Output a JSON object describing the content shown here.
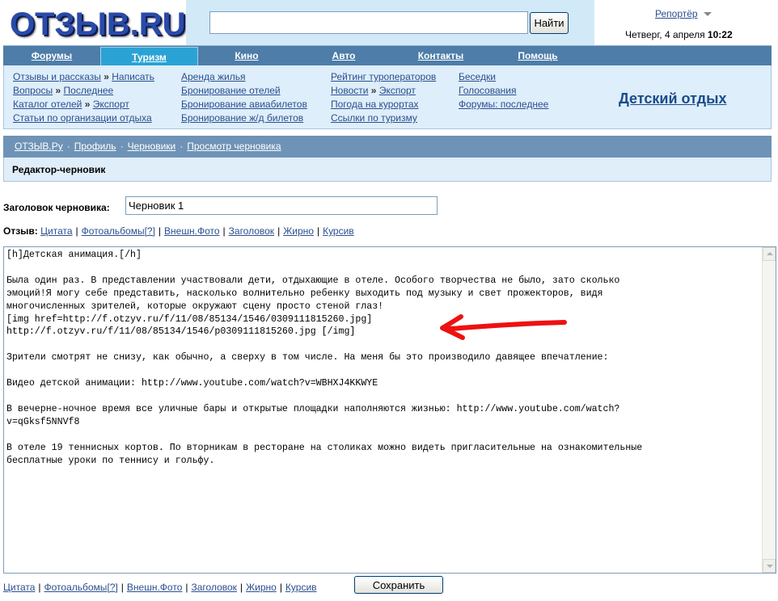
{
  "header": {
    "logo_text": "ОТЗЫВ.RU",
    "search_placeholder": "",
    "search_value": "",
    "search_button": "Найти",
    "reporter_label": "Репортёр",
    "date_text": "Четверг, 4 апреля",
    "time_text": "10:22"
  },
  "nav": {
    "tabs": [
      {
        "label": "Форумы"
      },
      {
        "label": "Туризм",
        "active": true
      },
      {
        "label": "Кино"
      },
      {
        "label": "Авто"
      },
      {
        "label": "Контакты"
      },
      {
        "label": "Помощь"
      }
    ]
  },
  "submenu": {
    "col1": {
      "r1a": "Отзывы и рассказы",
      "r1b": "Написать",
      "r2a": "Вопросы",
      "r2b": "Последнее",
      "r3a": "Каталог отелей",
      "r3b": "Экспорт",
      "r4": "Статьи по организации отдыха",
      "sep": "»"
    },
    "col2": [
      "Аренда жилья",
      "Бронирование отелей",
      "Бронирование авиабилетов",
      "Бронирование ж/д билетов"
    ],
    "col3": {
      "r1": "Рейтинг туроператоров",
      "r2a": "Новости",
      "r2b": "Экспорт",
      "r3": "Погода на курортах",
      "r4": "Ссылки по туризму"
    },
    "col4": [
      "Беседки",
      "Голосования",
      "Форумы: последнее"
    ],
    "kids_link": "Детский отдых"
  },
  "breadcrumb": {
    "items": [
      "ОТЗЫВ.Ру",
      "Профиль",
      "Черновики",
      "Просмотр черновика"
    ],
    "dot": "·"
  },
  "page_title": "Редактор-черновик",
  "draft": {
    "label": "Заголовок черновика:",
    "value": "Черновик 1"
  },
  "toolbar": {
    "label": "Отзыв:",
    "quote": "Цитата",
    "albums": "Фотоальбомы",
    "albums_help": "[?]",
    "external_photo": "Внешн.Фото",
    "heading": "Заголовок",
    "bold": "Жирно",
    "italic": "Курсив",
    "pipe": "|"
  },
  "editor": {
    "text": "[h]Детская анимация.[/h]\n\nБыла один раз. В представлении участвовали дети, отдыхающие в отеле. Особого творчества не было, зато сколько\nэмоций!Я могу себе представить, насколько волнительно ребенку выходить под музыку и свет прожекторов, видя\nмногочисленных зрителей, которые окружают сцену просто стеной глаз!\n[img href=http://f.otzyv.ru/f/11/08/85134/1546/0309111815260.jpg]\nhttp://f.otzyv.ru/f/11/08/85134/1546/p0309111815260.jpg [/img]\n\nЗрители смотрят не снизу, как обычно, а сверху в том числе. На меня бы это производило давящее впечатление:\n\nВидео детской анимации: http://www.youtube.com/watch?v=WBHXJ4KKWYE\n\nВ вечерне-ночное время все уличные бары и открытые площадки наполняются жизнью: http://www.youtube.com/watch?\nv=qGksf5NNVf8\n\nВ отеле 19 теннисных кортов. По вторникам в ресторане на столиках можно видеть пригласительные на ознакомительные\nбесплатные уроки по теннису и гольфу."
  },
  "save_button": "Сохранить",
  "colors": {
    "nav_bg": "#4d7da8",
    "nav_active": "#2aa3d4",
    "submenu_bg": "#deeefa",
    "link": "#2a4f8f",
    "annotation_arrow": "#ee1111"
  }
}
